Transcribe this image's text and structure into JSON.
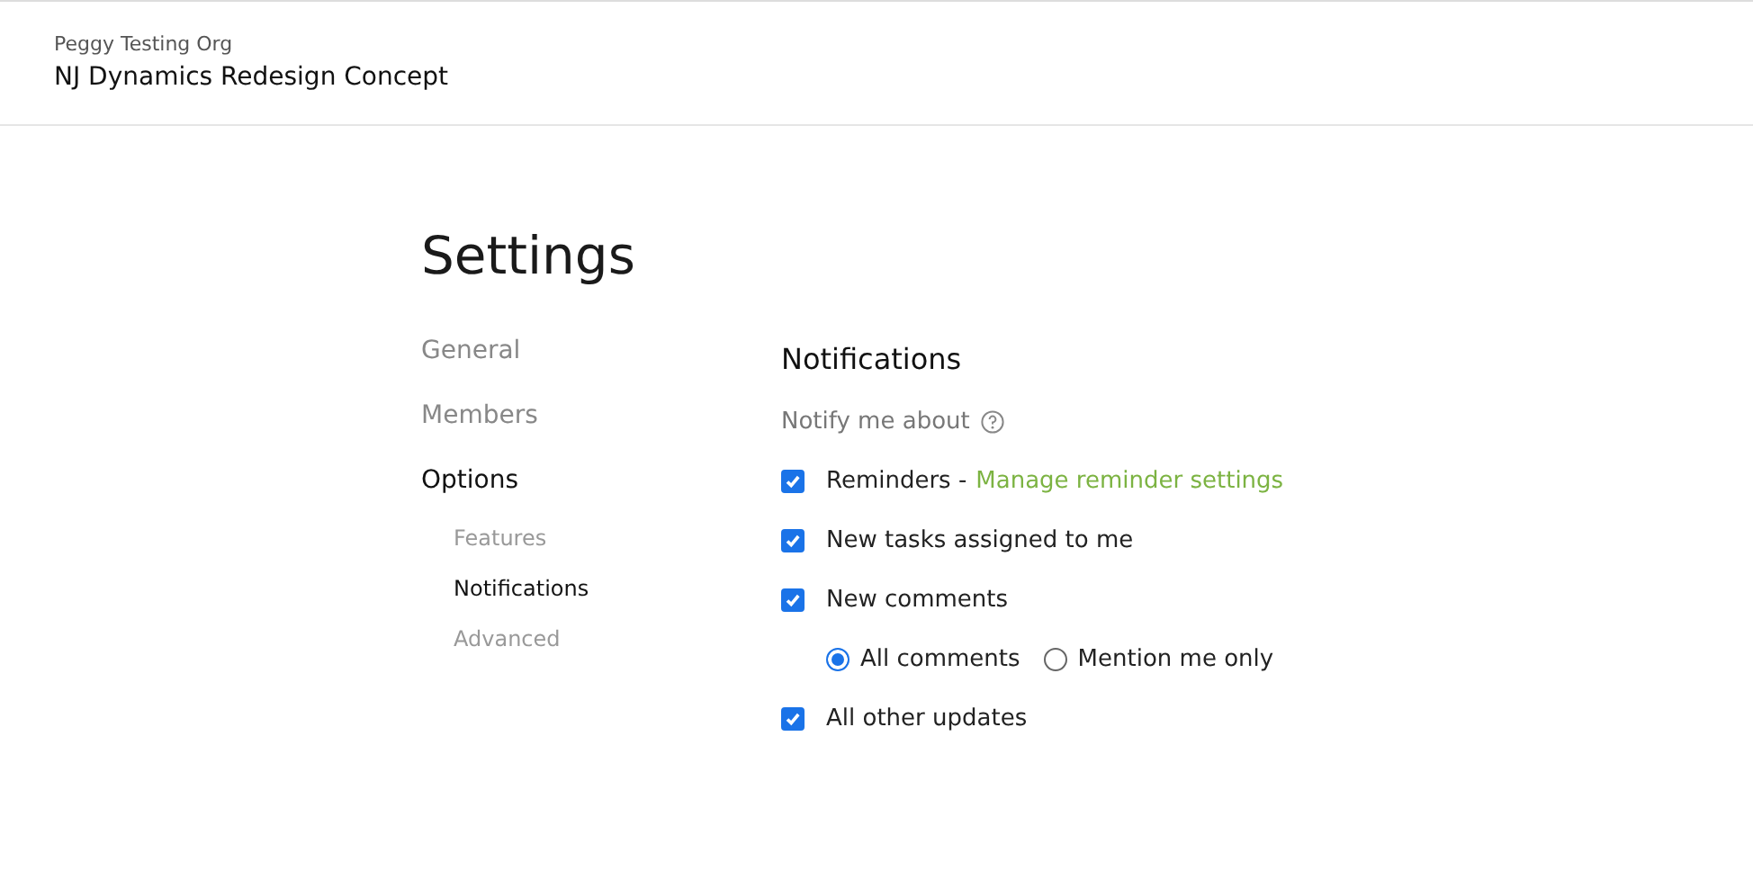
{
  "header": {
    "org": "Peggy Testing Org",
    "project": "NJ Dynamics Redesign Concept"
  },
  "page_title": "Settings",
  "sidebar": {
    "items": [
      {
        "label": "General",
        "selected": false
      },
      {
        "label": "Members",
        "selected": false
      },
      {
        "label": "Options",
        "selected": true,
        "children": [
          {
            "label": "Features",
            "selected": false
          },
          {
            "label": "Notifications",
            "selected": true
          },
          {
            "label": "Advanced",
            "selected": false
          }
        ]
      }
    ]
  },
  "notifications": {
    "heading": "Notifications",
    "subheading": "Notify me about",
    "options": [
      {
        "label": "Reminders -",
        "link": "Manage reminder settings",
        "checked": true
      },
      {
        "label": "New tasks assigned to me",
        "checked": true
      },
      {
        "label": "New comments",
        "checked": true,
        "choices": [
          {
            "label": "All comments",
            "selected": true
          },
          {
            "label": "Mention me only",
            "selected": false
          }
        ]
      },
      {
        "label": "All other updates",
        "checked": true
      }
    ]
  }
}
